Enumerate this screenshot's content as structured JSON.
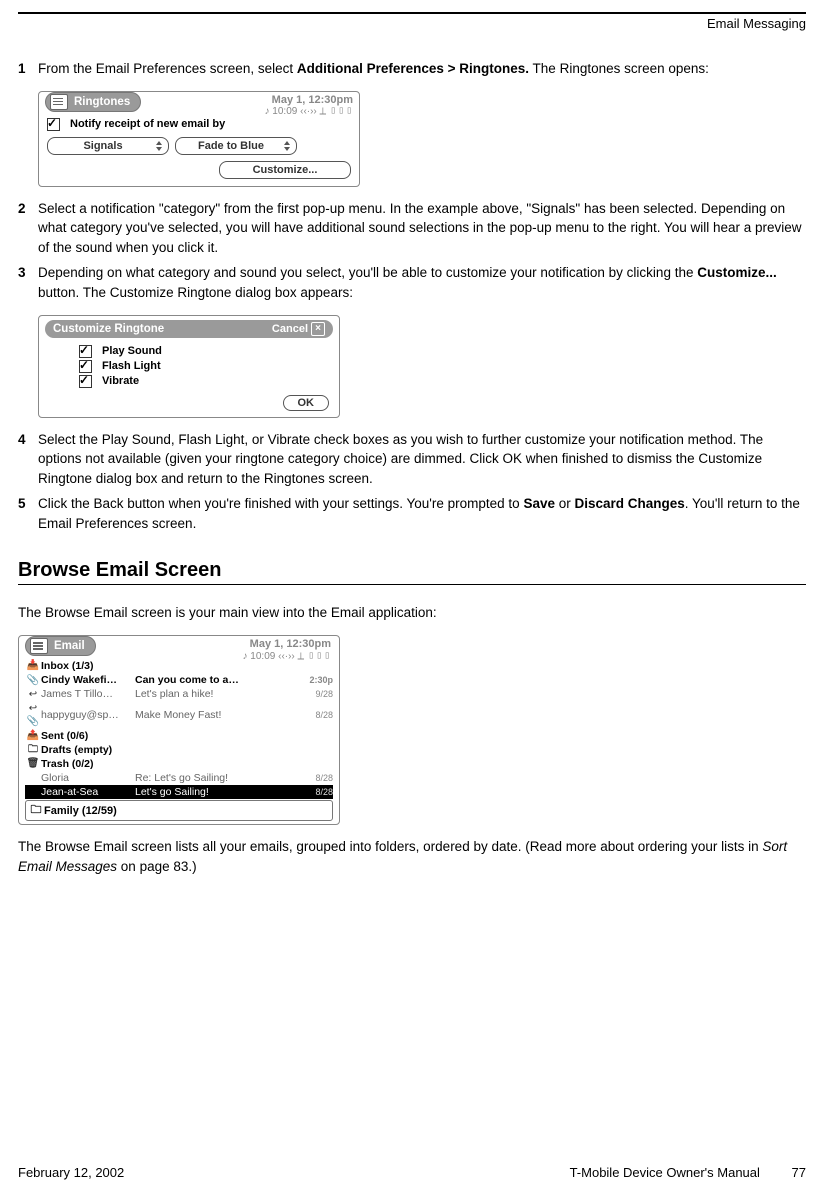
{
  "header": {
    "section": "Email Messaging"
  },
  "steps": {
    "s1": {
      "num": "1",
      "pre": "From the Email Preferences screen, select ",
      "bold": "Additional Preferences > Ringtones.",
      "post": " The Ringtones screen opens:"
    },
    "s2": {
      "num": "2",
      "text": "Select a notification \"category\" from the first pop-up menu. In the example above, \"Signals\" has been selected. Depending on what category you've selected, you will have additional sound selections in the pop-up menu to the right. You will hear a preview of the sound when you click it."
    },
    "s3": {
      "num": "3",
      "pre": "Depending on what category and sound you select, you'll be able to customize your notification by clicking the ",
      "bold": "Customize...",
      "post": " button. The Customize Ringtone dialog box appears:"
    },
    "s4": {
      "num": "4",
      "text": "Select the Play Sound, Flash Light, or Vibrate check boxes as you wish to further customize your notification method. The options not available (given your ringtone category choice) are dimmed. Click OK when finished to dismiss the Customize Ringtone dialog box and return to the Ringtones screen."
    },
    "s5": {
      "num": "5",
      "pre": "Click the Back button when you're finished with your settings. You're prompted to ",
      "b1": "Save",
      "mid": " or ",
      "b2": "Discard Changes",
      "post": ". You'll return to the Email Preferences screen."
    }
  },
  "device1": {
    "title": "Ringtones",
    "date": "May 1, 12:30pm",
    "sub": "♪ 10:09  ‹‹·›› ⟂ ▯▯▯",
    "notify": "Notify receipt of new email by",
    "category": "Signals",
    "sound": "Fade to Blue",
    "customize": "Customize..."
  },
  "device2": {
    "title": "Customize Ringtone",
    "cancel": "Cancel",
    "opts": {
      "play": "Play Sound",
      "flash": "Flash Light",
      "vib": "Vibrate"
    },
    "ok": "OK"
  },
  "h2": "Browse Email Screen",
  "intro": "The Browse Email screen is your main view into the Email application:",
  "device3": {
    "title": "Email",
    "date": "May 1, 12:30pm",
    "sub": "♪ 10:09  ‹‹·›› ⟂ ▯▯▯",
    "inbox": "Inbox (1/3)",
    "m1": {
      "from": "Cindy Wakefi…",
      "subj": "Can you come to a…",
      "time": "2:30p"
    },
    "m2": {
      "from": "James T Tillo…",
      "subj": "Let's plan a hike!",
      "time": "9/28"
    },
    "m3": {
      "from": "happyguy@sp…",
      "subj": "Make Money Fast!",
      "time": "8/28"
    },
    "sent": "Sent (0/6)",
    "drafts": "Drafts (empty)",
    "trash": "Trash (0/2)",
    "m4": {
      "from": "Gloria",
      "subj": "Re: Let's go Sailing!",
      "time": "8/28"
    },
    "m5": {
      "from": "Jean-at-Sea",
      "subj": "Let's go Sailing!",
      "time": "8/28"
    },
    "family": "Family (12/59)"
  },
  "outro": {
    "pre": "The Browse Email screen lists all your emails, grouped into folders, ordered by date. (Read more about ordering your lists in ",
    "ital": "Sort Email Messages",
    "post": " on page 83.)"
  },
  "footer": {
    "left": "February 12, 2002",
    "center": "T-Mobile Device Owner's Manual",
    "page": "77"
  }
}
